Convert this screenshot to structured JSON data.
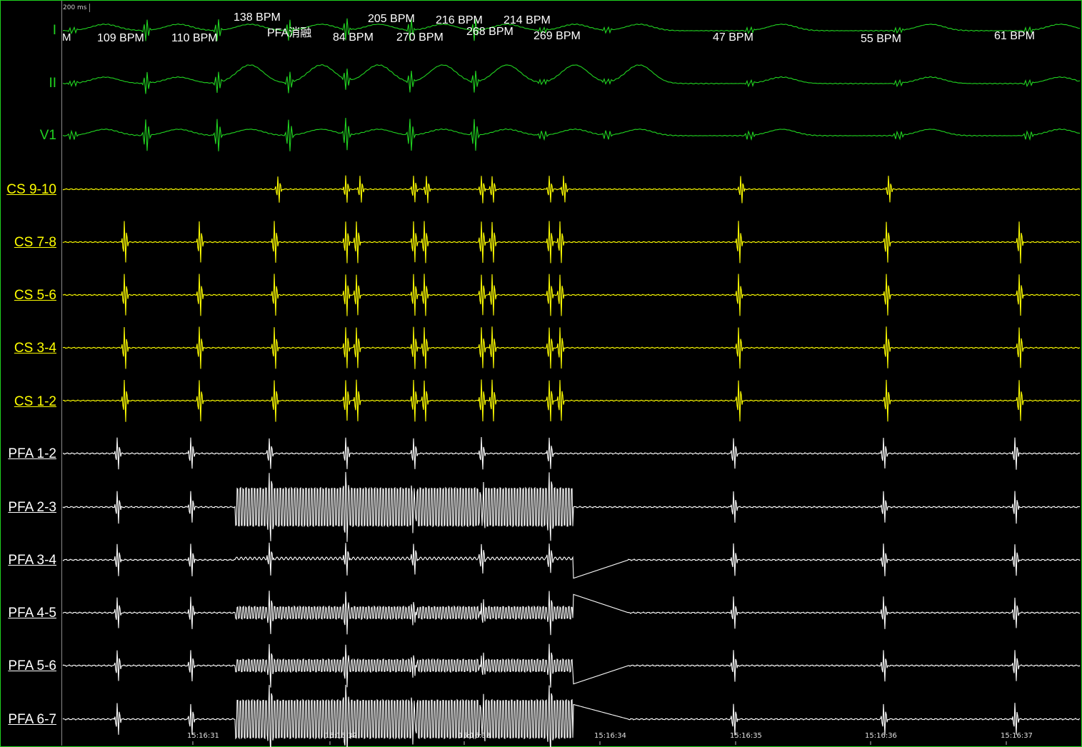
{
  "scale_label": "200 ms",
  "marker_label": "M",
  "event_label": "PFA消融",
  "channels": [
    {
      "label": "I",
      "color": "#21d421",
      "underlined": false
    },
    {
      "label": "II",
      "color": "#21d421",
      "underlined": false
    },
    {
      "label": "V1",
      "color": "#21d421",
      "underlined": false
    },
    {
      "label": "CS 9-10",
      "color": "#ffff00",
      "underlined": true
    },
    {
      "label": "CS 7-8",
      "color": "#ffff00",
      "underlined": true
    },
    {
      "label": "CS 5-6",
      "color": "#ffff00",
      "underlined": true
    },
    {
      "label": "CS 3-4",
      "color": "#ffff00",
      "underlined": true
    },
    {
      "label": "CS 1-2",
      "color": "#ffff00",
      "underlined": true
    },
    {
      "label": "PFA 1-2",
      "color": "#ffffff",
      "underlined": true
    },
    {
      "label": "PFA 2-3",
      "color": "#ffffff",
      "underlined": true
    },
    {
      "label": "PFA 3-4",
      "color": "#ffffff",
      "underlined": true
    },
    {
      "label": "PFA 4-5",
      "color": "#ffffff",
      "underlined": true
    },
    {
      "label": "PFA 5-6",
      "color": "#ffffff",
      "underlined": true
    },
    {
      "label": "PFA 6-7",
      "color": "#ffffff",
      "underlined": true
    }
  ],
  "bpm_labels": [
    "109 BPM",
    "110 BPM",
    "138 BPM",
    "84 BPM",
    "205 BPM",
    "270 BPM",
    "216 BPM",
    "268 BPM",
    "214 BPM",
    "269 BPM",
    "47 BPM",
    "55 BPM",
    "61 BPM"
  ],
  "time_labels": [
    "15:16:31",
    "15:16:32",
    "15:16:33",
    "15:16:34",
    "15:16:35",
    "15:16:36",
    "15:16:37"
  ],
  "colors": {
    "surface_ecg": "#21d421",
    "cs": "#ffff00",
    "pfa": "#ffffff",
    "frame": "#1fd21f",
    "background": "#000000"
  }
}
